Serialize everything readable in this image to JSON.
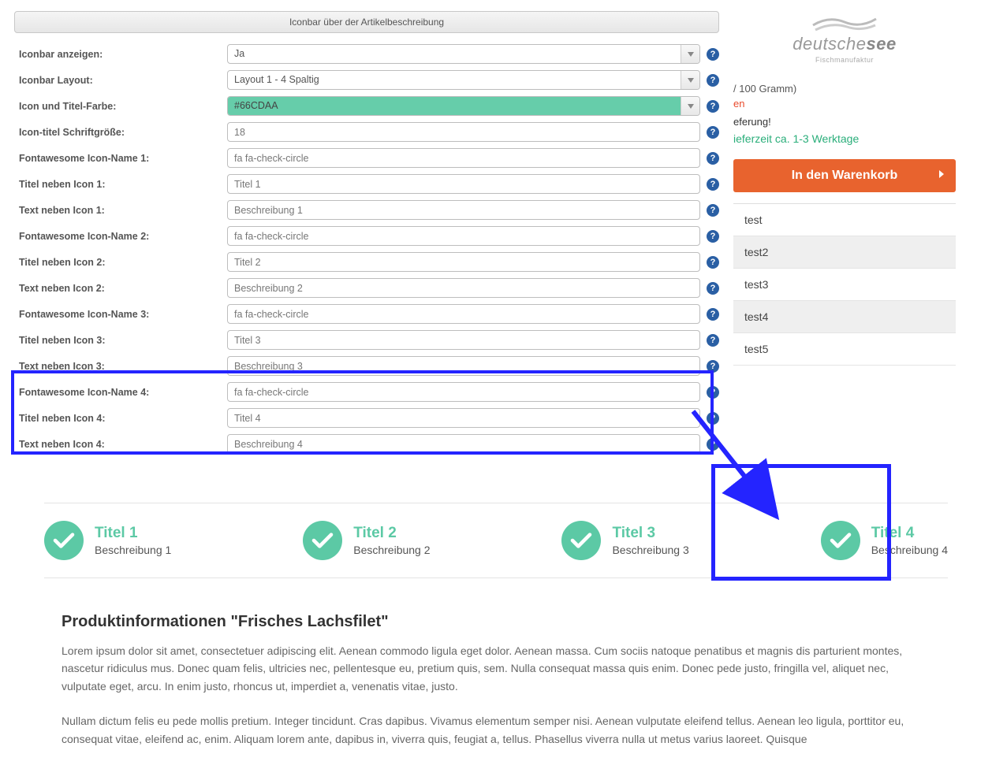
{
  "section_title": "Iconbar über der Artikelbeschreibung",
  "rows": [
    {
      "label": "Iconbar anzeigen:",
      "kind": "select",
      "value": "Ja"
    },
    {
      "label": "Iconbar Layout:",
      "kind": "select",
      "value": "Layout 1 - 4 Spaltig"
    },
    {
      "label": "Icon und Titel-Farbe:",
      "kind": "color",
      "value": "#66CDAA"
    },
    {
      "label": "Icon-titel Schriftgröße:",
      "kind": "text",
      "value": "18"
    },
    {
      "label": "Fontawesome Icon-Name 1:",
      "kind": "text",
      "value": "fa fa-check-circle"
    },
    {
      "label": "Titel neben Icon 1:",
      "kind": "text",
      "value": "Titel 1"
    },
    {
      "label": "Text neben Icon 1:",
      "kind": "text",
      "value": "Beschreibung 1"
    },
    {
      "label": "Fontawesome Icon-Name 2:",
      "kind": "text",
      "value": "fa fa-check-circle"
    },
    {
      "label": "Titel neben Icon 2:",
      "kind": "text",
      "value": "Titel 2"
    },
    {
      "label": "Text neben Icon 2:",
      "kind": "text",
      "value": "Beschreibung 2"
    },
    {
      "label": "Fontawesome Icon-Name 3:",
      "kind": "text",
      "value": "fa fa-check-circle"
    },
    {
      "label": "Titel neben Icon 3:",
      "kind": "text",
      "value": "Titel 3"
    },
    {
      "label": "Text neben Icon 3:",
      "kind": "text",
      "value": "Beschreibung 3"
    },
    {
      "label": "Fontawesome Icon-Name 4:",
      "kind": "text",
      "value": "fa fa-check-circle"
    },
    {
      "label": "Titel neben Icon 4:",
      "kind": "text",
      "value": "Titel 4"
    },
    {
      "label": "Text neben Icon 4:",
      "kind": "text",
      "value": "Beschreibung 4"
    }
  ],
  "right": {
    "brand_line1": "deutsche",
    "brand_line1b": "see",
    "brand_sub": "Fischmanufaktur",
    "per_unit": "/ 100 Gramm)",
    "stock_txt": "en",
    "ship_txt": "eferung!",
    "leadtime": "ieferzeit ca. 1-3 Werktage",
    "cart_label": "In den Warenkorb",
    "tabs": [
      "test",
      "test2",
      "test3",
      "test4",
      "test5"
    ]
  },
  "iconbar": [
    {
      "title": "Titel 1",
      "desc": "Beschreibung 1"
    },
    {
      "title": "Titel 2",
      "desc": "Beschreibung 2"
    },
    {
      "title": "Titel 3",
      "desc": "Beschreibung 3"
    },
    {
      "title": "Titel 4",
      "desc": "Beschreibung 4"
    }
  ],
  "product": {
    "heading": "Produktinformationen \"Frisches Lachsfilet\"",
    "p1": "Lorem ipsum dolor sit amet, consectetuer adipiscing elit. Aenean commodo ligula eget dolor. Aenean massa. Cum sociis natoque penatibus et magnis dis parturient montes, nascetur ridiculus mus. Donec quam felis, ultricies nec, pellentesque eu, pretium quis, sem. Nulla consequat massa quis enim. Donec pede justo, fringilla vel, aliquet nec, vulputate eget, arcu. In enim justo, rhoncus ut, imperdiet a, venenatis vitae, justo.",
    "p2": "Nullam dictum felis eu pede mollis pretium. Integer tincidunt. Cras dapibus. Vivamus elementum semper nisi. Aenean vulputate eleifend tellus. Aenean leo ligula, porttitor eu, consequat vitae, eleifend ac, enim. Aliquam lorem ante, dapibus in, viverra quis, feugiat a, tellus. Phasellus viverra nulla ut metus varius laoreet. Quisque"
  }
}
